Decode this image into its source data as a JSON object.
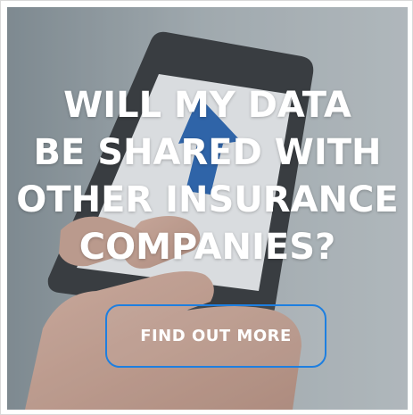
{
  "banner": {
    "headline_lines": [
      "WILL MY DATA",
      "BE SHARED WITH",
      "OTHER INSURANCE",
      "COMPANIES?"
    ],
    "cta_label": "FIND OUT MORE",
    "cta_border_color": "#1e7fe0",
    "text_color": "#ffffff",
    "image": "hand-holding-smartphone"
  }
}
